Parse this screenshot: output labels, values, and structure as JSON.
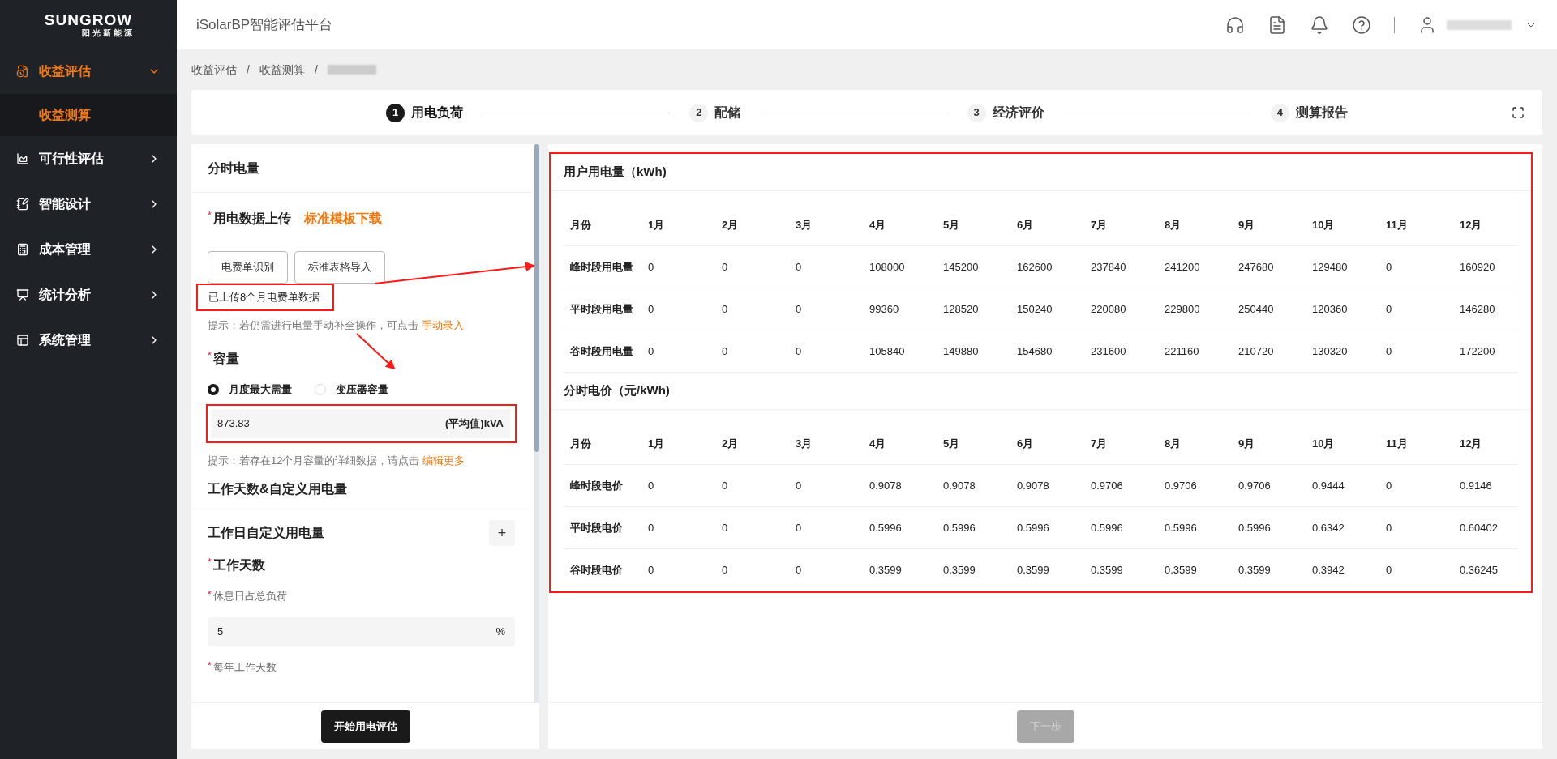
{
  "sidebar": {
    "logo": {
      "brand": "SUNGROW",
      "sub": "阳光新能源"
    },
    "items": [
      {
        "label": "收益评估",
        "expanded": true,
        "children": [
          {
            "label": "收益测算",
            "selected": true
          }
        ]
      },
      {
        "label": "可行性评估",
        "expanded": false
      },
      {
        "label": "智能设计",
        "expanded": false
      },
      {
        "label": "成本管理",
        "expanded": false
      },
      {
        "label": "统计分析",
        "expanded": false
      },
      {
        "label": "系统管理",
        "expanded": false
      }
    ]
  },
  "header": {
    "title": "iSolarBP智能评估平台"
  },
  "breadcrumb": {
    "items": [
      "收益评估",
      "收益测算"
    ],
    "separator": "/"
  },
  "steps": [
    {
      "number": "1",
      "label": "用电负荷",
      "selected": true
    },
    {
      "number": "2",
      "label": "配储",
      "selected": false
    },
    {
      "number": "3",
      "label": "经济评价",
      "selected": false
    },
    {
      "number": "4",
      "label": "测算报告",
      "selected": false
    }
  ],
  "left_panel": {
    "title": "分时电量",
    "upload": {
      "mark": "*",
      "label": "用电数据上传",
      "link": "标准模板下载",
      "buttons": [
        "电费单识别",
        "标准表格导入"
      ],
      "note": "已上传8个月电费单数据",
      "hint": "提示：若仍需进行电量手动补全操作，可点击",
      "hint_link": "手动录入"
    },
    "capacity": {
      "mark": "*",
      "label": "容量",
      "radios": [
        {
          "label": "月度最大需量",
          "selected": true
        },
        {
          "label": "变压器容量",
          "selected": false
        }
      ],
      "value": "873.83",
      "suffix": "(平均值)kVA",
      "hint": "提示：若存在12个月容量的详细数据，请点击",
      "hint_link": "编辑更多"
    },
    "section2_title": "工作天数&自定义用电量",
    "custom_title": "工作日自定义用电量",
    "add_button": "+",
    "workdays": {
      "mark": "*",
      "label": "工作天数"
    },
    "rest_field": {
      "mark": "*",
      "label": "休息日占总负荷",
      "value": "5",
      "suffix": "%"
    },
    "year_field": {
      "mark": "*",
      "label": "每年工作天数"
    },
    "start_button": "开始用电评估"
  },
  "tables": [
    {
      "title": "用户用电量（kWh)",
      "corner": "月份",
      "columns": [
        "1月",
        "2月",
        "3月",
        "4月",
        "5月",
        "6月",
        "7月",
        "8月",
        "9月",
        "10月",
        "11月",
        "12月"
      ],
      "rows": [
        {
          "label": "峰时段用电量",
          "cells": [
            "0",
            "0",
            "0",
            "108000",
            "145200",
            "162600",
            "237840",
            "241200",
            "247680",
            "129480",
            "0",
            "160920"
          ]
        },
        {
          "label": "平时段用电量",
          "cells": [
            "0",
            "0",
            "0",
            "99360",
            "128520",
            "150240",
            "220080",
            "229800",
            "250440",
            "120360",
            "0",
            "146280"
          ]
        },
        {
          "label": "谷时段用电量",
          "cells": [
            "0",
            "0",
            "0",
            "105840",
            "149880",
            "154680",
            "231600",
            "221160",
            "210720",
            "130320",
            "0",
            "172200"
          ]
        }
      ]
    },
    {
      "title": "分时电价（元/kWh)",
      "corner": "月份",
      "columns": [
        "1月",
        "2月",
        "3月",
        "4月",
        "5月",
        "6月",
        "7月",
        "8月",
        "9月",
        "10月",
        "11月",
        "12月"
      ],
      "rows": [
        {
          "label": "峰时段电价",
          "cells": [
            "0",
            "0",
            "0",
            "0.9078",
            "0.9078",
            "0.9078",
            "0.9706",
            "0.9706",
            "0.9706",
            "0.9444",
            "0",
            "0.9146"
          ]
        },
        {
          "label": "平时段电价",
          "cells": [
            "0",
            "0",
            "0",
            "0.5996",
            "0.5996",
            "0.5996",
            "0.5996",
            "0.5996",
            "0.5996",
            "0.6342",
            "0",
            "0.60402"
          ]
        },
        {
          "label": "谷时段电价",
          "cells": [
            "0",
            "0",
            "0",
            "0.3599",
            "0.3599",
            "0.3599",
            "0.3599",
            "0.3599",
            "0.3599",
            "0.3942",
            "0",
            "0.36245"
          ]
        }
      ]
    }
  ],
  "next_button": {
    "label": "下一步",
    "disabled": true
  }
}
